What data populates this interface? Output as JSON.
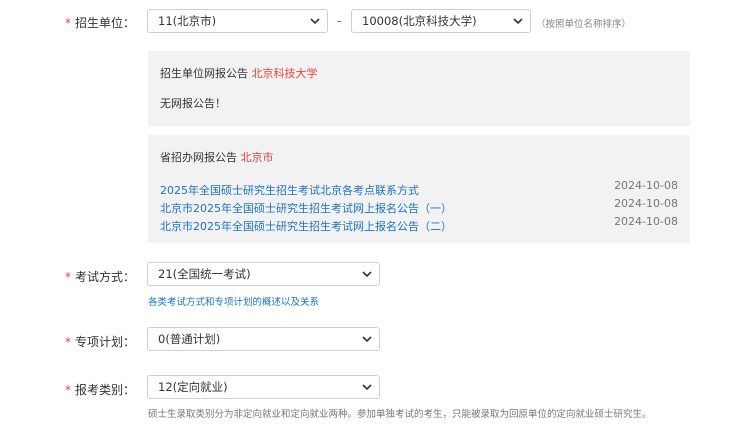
{
  "colors": {
    "required": "#e64340",
    "link": "#1a73c8",
    "panel": "#f2f2f2"
  },
  "icons": {
    "select_arrow": "chevron-down-icon"
  },
  "unit": {
    "label": "招生单位：",
    "province_value": "11(北京市)",
    "separator": "-",
    "school_value": "10008(北京科技大学)",
    "hint": "（按照单位名称排序）"
  },
  "unit_notice": {
    "title": "招生单位网报公告",
    "school": "北京科技大学",
    "empty": "无网报公告！"
  },
  "province_notice": {
    "title": "省招办网报公告",
    "province": "北京市",
    "items": [
      {
        "title": "2025年全国硕士研究生招生考试北京各考点联系方式",
        "date": "2024-10-08"
      },
      {
        "title": "北京市2025年全国硕士研究生招生考试网上报名公告（一）",
        "date": "2024-10-08"
      },
      {
        "title": "北京市2025年全国硕士研究生招生考试网上报名公告（二）",
        "date": "2024-10-08"
      }
    ]
  },
  "exam_mode": {
    "label": "考试方式：",
    "value": "21(全国统一考试)",
    "help": "各类考试方式和专项计划的概述以及关系"
  },
  "special_plan": {
    "label": "专项计划：",
    "value": "0(普通计划)"
  },
  "category": {
    "label": "报考类别：",
    "value": "12(定向就业)",
    "note": "硕士生录取类别分为非定向就业和定向就业两种。参加单独考试的考生，只能被录取为回原单位的定向就业硕士研究生。"
  }
}
